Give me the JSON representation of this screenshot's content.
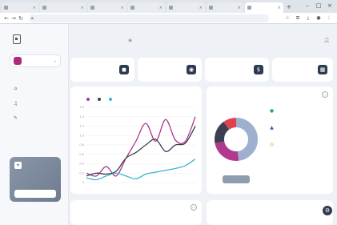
{
  "browser": {
    "tabs": [
      {
        "title": ""
      },
      {
        "title": ""
      },
      {
        "title": ""
      },
      {
        "title": ""
      },
      {
        "title": ""
      },
      {
        "title": ""
      },
      {
        "title": ""
      }
    ],
    "url": ""
  },
  "sidebar": {
    "brand": "",
    "workspace": {
      "initial": "",
      "name": ""
    },
    "section_title": "",
    "items": [
      {
        "label": "",
        "icon": "home-icon"
      },
      {
        "label": "",
        "icon": "bell-icon"
      },
      {
        "label": "",
        "icon": "pin-icon"
      }
    ],
    "promo": {
      "title": "",
      "subtitle": "",
      "button": ""
    }
  },
  "header": {
    "breadcrumb": "",
    "title": "",
    "user_name": ""
  },
  "stats": [
    {
      "title": "",
      "value": "",
      "delta": "",
      "icon": "box-icon"
    },
    {
      "title": "",
      "value": "",
      "delta": "",
      "icon": "globe-icon"
    },
    {
      "title": "",
      "value": "",
      "delta": "",
      "icon": "dollar-icon"
    },
    {
      "title": "",
      "value": "",
      "delta": "",
      "icon": "grid-icon"
    }
  ],
  "line_chart": {
    "title": "",
    "colors": [
      "#b03a8e",
      "#3a3f52",
      "#39b7c7"
    ],
    "chart_data": {
      "type": "line",
      "title": "",
      "xlabel": "",
      "ylabel": "",
      "x": [
        "",
        "",
        "",
        "",
        "",
        "",
        "",
        "",
        "",
        "",
        "",
        ""
      ],
      "ylim": [
        0,
        1.6
      ],
      "yticks": [
        "1.6",
        "1.4",
        "1.2",
        "1.0",
        "0.8",
        "0.6",
        "0.4",
        "0.2",
        "0"
      ],
      "series": [
        {
          "name": "",
          "values": [
            0.2,
            0.14,
            0.34,
            0.14,
            0.52,
            0.88,
            1.26,
            0.88,
            1.34,
            0.9,
            0.88,
            1.4
          ]
        },
        {
          "name": "",
          "values": [
            0.14,
            0.2,
            0.18,
            0.24,
            0.52,
            0.64,
            0.8,
            0.92,
            0.66,
            0.8,
            0.84,
            1.2
          ]
        },
        {
          "name": "",
          "values": [
            0.1,
            0.06,
            0.14,
            0.2,
            0.14,
            0.08,
            0.18,
            0.22,
            0.26,
            0.3,
            0.36,
            0.5
          ]
        }
      ],
      "grid": true,
      "legend": "top-left"
    }
  },
  "donut": {
    "title": "",
    "button": "",
    "items": [
      {
        "label": "",
        "value": "",
        "icon": "globe-icon",
        "color": "#2bb26b"
      },
      {
        "label": "",
        "value": "",
        "icon": "triangle-icon",
        "color": "#3a56c9"
      },
      {
        "label": "",
        "value": "",
        "icon": "chrome-icon",
        "color": "#e6a13a"
      }
    ],
    "chart_data": {
      "type": "pie",
      "labels": [
        "",
        "",
        "",
        ""
      ],
      "values": [
        48,
        24,
        18,
        10
      ],
      "colors": [
        "#9fb0cf",
        "#b03a8e",
        "#3a3f52",
        "#e0424d"
      ]
    }
  },
  "bottom_left": {
    "title": "",
    "row": ""
  },
  "bottom_right": {
    "title": "",
    "cols": [
      "",
      "",
      ""
    ]
  }
}
